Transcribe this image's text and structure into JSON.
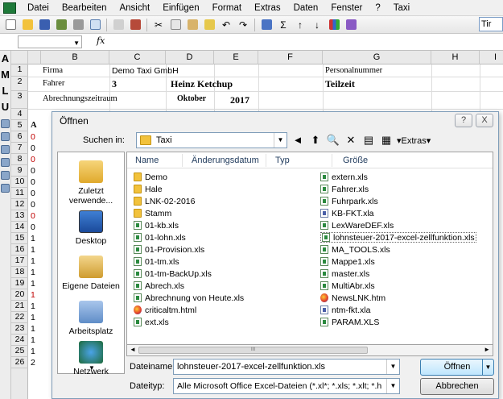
{
  "menu": [
    "Datei",
    "Bearbeiten",
    "Ansicht",
    "Einfügen",
    "Format",
    "Extras",
    "Daten",
    "Fenster",
    "?",
    "Taxi"
  ],
  "toolbar": {
    "font_name": "Tir"
  },
  "formula_bar": {
    "fx": "fx",
    "name_box": ""
  },
  "left_strip": [
    "A",
    "M",
    "L",
    "U"
  ],
  "columns": [
    "B",
    "C",
    "D",
    "E",
    "F",
    "G",
    "H",
    "I"
  ],
  "rows": [
    "1",
    "2",
    "3",
    "4",
    "5",
    "6",
    "7",
    "8",
    "9",
    "10",
    "11",
    "12",
    "13",
    "14",
    "15",
    "16",
    "17",
    "18",
    "19",
    "20",
    "21",
    "22",
    "23",
    "24",
    "25",
    "26"
  ],
  "sheet": {
    "r1_b": "Firma",
    "r1_c": "Demo Taxi GmbH",
    "r1_g": "Personalnummer",
    "r2_b": "Fahrer",
    "r2_c": "3",
    "r2_d": "Heinz Ketchup",
    "r2_g": "Teilzeit",
    "r3_b": "Abrechnungszeitraum",
    "r3_d": "Oktober",
    "r3_e": "2017",
    "a5": "A",
    "colA": [
      "0",
      "0",
      "0",
      "0",
      "0",
      "0",
      "0",
      "0",
      "0",
      "1",
      "1",
      "1",
      "1",
      "1",
      "1",
      "1",
      "1",
      "1",
      "1",
      "1",
      "2"
    ]
  },
  "dialog": {
    "title": "Öffnen",
    "help_btn": "?",
    "close_btn": "X",
    "look_in_label": "Suchen in:",
    "look_in_value": "Taxi",
    "extras_label": "Extras",
    "places": [
      "Zuletzt verwende...",
      "Desktop",
      "Eigene Dateien",
      "Arbeitsplatz",
      "Netzwerk"
    ],
    "columns": [
      "Name",
      "Änderungsdatum",
      "Typ",
      "Größe"
    ],
    "files_left": [
      {
        "name": "Demo",
        "icon": "folder"
      },
      {
        "name": "Hale",
        "icon": "folder"
      },
      {
        "name": "LNK-02-2016",
        "icon": "folder"
      },
      {
        "name": "Stamm",
        "icon": "folder"
      },
      {
        "name": "01-kb.xls",
        "icon": "xls"
      },
      {
        "name": "01-lohn.xls",
        "icon": "xls"
      },
      {
        "name": "01-Provision.xls",
        "icon": "xls"
      },
      {
        "name": "01-tm.xls",
        "icon": "xls"
      },
      {
        "name": "01-tm-BackUp.xls",
        "icon": "xls"
      },
      {
        "name": "Abrech.xls",
        "icon": "xls"
      },
      {
        "name": "Abrechnung von Heute.xls",
        "icon": "xls"
      },
      {
        "name": "criticaltm.html",
        "icon": "html"
      },
      {
        "name": "ext.xls",
        "icon": "xls"
      }
    ],
    "files_right": [
      {
        "name": "extern.xls",
        "icon": "xls"
      },
      {
        "name": "Fahrer.xls",
        "icon": "xls"
      },
      {
        "name": "Fuhrpark.xls",
        "icon": "xls"
      },
      {
        "name": "KB-FKT.xla",
        "icon": "xla"
      },
      {
        "name": "LexWareDEF.xls",
        "icon": "xls"
      },
      {
        "name": "lohnsteuer-2017-excel-zellfunktion.xls",
        "icon": "xls",
        "selected": true
      },
      {
        "name": "MA_TOOLS.xls",
        "icon": "xls"
      },
      {
        "name": "Mappe1.xls",
        "icon": "xls"
      },
      {
        "name": "master.xls",
        "icon": "xls"
      },
      {
        "name": "MultiAbr.xls",
        "icon": "xls"
      },
      {
        "name": "NewsLNK.htm",
        "icon": "html"
      },
      {
        "name": "ntm-fkt.xla",
        "icon": "xla"
      },
      {
        "name": "PARAM.XLS",
        "icon": "xls"
      }
    ],
    "filename_label": "Dateiname:",
    "filename_value": "lohnsteuer-2017-excel-zellfunktion.xls",
    "filetype_label": "Dateityp:",
    "filetype_value": "Alle Microsoft Office Excel-Dateien (*.xl*; *.xls; *.xlt; *.h",
    "open_btn": "Öffnen",
    "cancel_btn": "Abbrechen"
  }
}
